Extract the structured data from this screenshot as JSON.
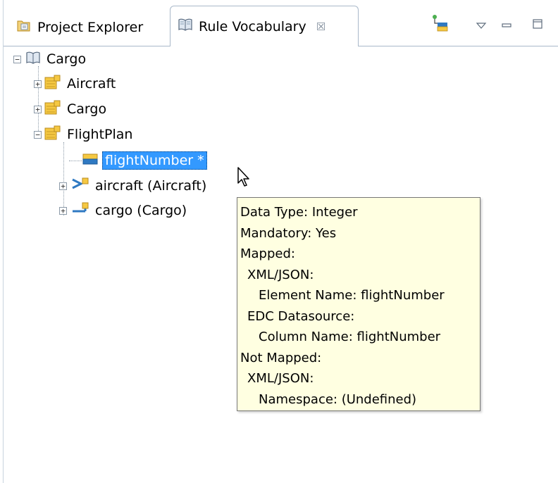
{
  "tabs": {
    "project_explorer": "Project Explorer",
    "rule_vocabulary": "Rule Vocabulary",
    "close_glyph": "☒"
  },
  "icons": {
    "project_explorer": "project-explorer-icon",
    "rule_vocabulary": "book-icon",
    "entity": "entity-folder-icon",
    "attribute": "attribute-icon",
    "association_out": "association-arrow-icon",
    "association_back": "association-back-icon",
    "new": "new-entity-icon",
    "menu": "view-menu-icon",
    "minimize": "minimize-icon",
    "maximize": "maximize-icon"
  },
  "tree": {
    "root": "Cargo",
    "entities": [
      "Aircraft",
      "Cargo",
      "FlightPlan"
    ],
    "flightplan_children": {
      "attribute": "flightNumber *",
      "association1": "aircraft (Aircraft)",
      "association2": "cargo (Cargo)"
    }
  },
  "tooltip": {
    "lines": [
      {
        "text": "Data Type: Integer",
        "level": 0
      },
      {
        "text": "Mandatory: Yes",
        "level": 0
      },
      {
        "text": "Mapped:",
        "level": 0
      },
      {
        "text": "XML/JSON:",
        "level": 1
      },
      {
        "text": "Element Name: flightNumber",
        "level": 2
      },
      {
        "text": "EDC Datasource:",
        "level": 1
      },
      {
        "text": "Column Name: flightNumber",
        "level": 2
      },
      {
        "text": "Not Mapped:",
        "level": 0
      },
      {
        "text": "XML/JSON:",
        "level": 1
      },
      {
        "text": "Namespace: (Undefined)",
        "level": 2
      }
    ]
  },
  "colors": {
    "selection": "#3399ff",
    "tooltip_bg": "#ffffe1",
    "folder_gold": "#f5c842",
    "link_blue": "#2f79c2"
  }
}
